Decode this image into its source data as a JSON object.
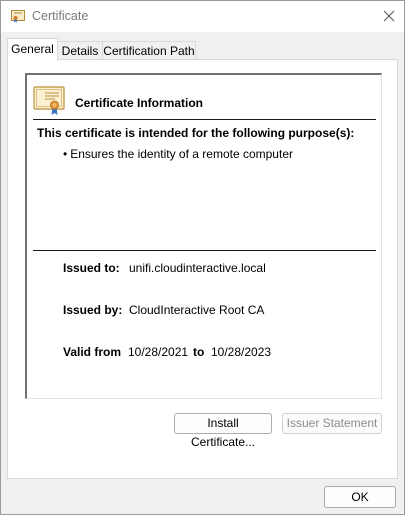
{
  "window": {
    "title": "Certificate"
  },
  "tabs": [
    {
      "label": "General",
      "active": true
    },
    {
      "label": "Details",
      "active": false
    },
    {
      "label": "Certification Path",
      "active": false
    }
  ],
  "general": {
    "info_title": "Certificate Information",
    "purpose_heading": "This certificate is intended for the following purpose(s):",
    "purposes": [
      "Ensures the identity of a remote computer"
    ],
    "bullet": "•",
    "issued_to_label": "Issued to:",
    "issued_to_value": "unifi.cloudinteractive.local",
    "issued_by_label": "Issued by:",
    "issued_by_value": "CloudInteractive Root CA",
    "valid_from_label": "Valid from",
    "valid_from_value": "10/28/2021",
    "valid_to_label": "to",
    "valid_to_value": "10/28/2023"
  },
  "buttons": {
    "install": "Install Certificate...",
    "issuer_statement": "Issuer Statement",
    "ok": "OK"
  },
  "icons": {
    "title": "certificate-icon",
    "close": "close-icon",
    "cert_info": "certificate-icon"
  },
  "colors": {
    "window_bg": "#f0f0f0",
    "panel_bg": "#ffffff",
    "title_text": "#7a7a7a",
    "disabled_text": "#8c8c8c"
  }
}
